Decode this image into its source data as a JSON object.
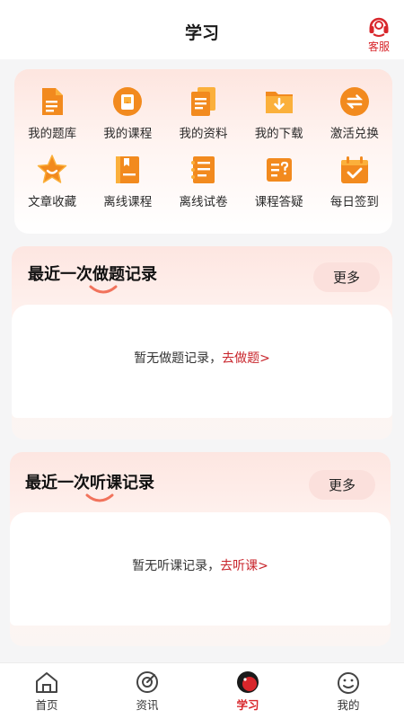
{
  "header": {
    "title": "学习",
    "service_label": "客服"
  },
  "grid": {
    "items": [
      {
        "label": "我的题库",
        "icon": "question-bank-icon"
      },
      {
        "label": "我的课程",
        "icon": "course-icon"
      },
      {
        "label": "我的资料",
        "icon": "materials-icon"
      },
      {
        "label": "我的下载",
        "icon": "download-folder-icon"
      },
      {
        "label": "激活兑换",
        "icon": "exchange-icon"
      },
      {
        "label": "文章收藏",
        "icon": "star-icon"
      },
      {
        "label": "离线课程",
        "icon": "offline-course-icon"
      },
      {
        "label": "离线试卷",
        "icon": "offline-paper-icon"
      },
      {
        "label": "课程答疑",
        "icon": "question-answer-icon"
      },
      {
        "label": "每日签到",
        "icon": "calendar-check-icon"
      }
    ]
  },
  "practice_record": {
    "title": "最近一次做题记录",
    "more_label": "更多",
    "empty_text": "暂无做题记录，",
    "link_text": "去做题>"
  },
  "listen_record": {
    "title": "最近一次听课记录",
    "more_label": "更多",
    "empty_text": "暂无听课记录，",
    "link_text": "去听课>"
  },
  "tabbar": {
    "tabs": [
      {
        "label": "首页",
        "icon": "home-icon"
      },
      {
        "label": "资讯",
        "icon": "news-icon"
      },
      {
        "label": "学习",
        "icon": "study-icon",
        "active": true
      },
      {
        "label": "我的",
        "icon": "profile-icon"
      }
    ]
  },
  "colors": {
    "accent": "#d8262b",
    "icon_orange": "#f28a1e",
    "icon_orange_light": "#fbb03b"
  }
}
